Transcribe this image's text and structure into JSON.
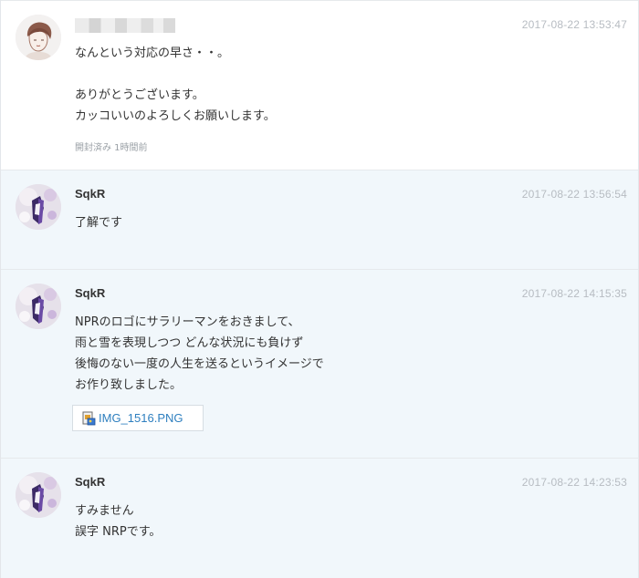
{
  "messages": [
    {
      "sender": "",
      "timestamp": "2017-08-22 13:53:47",
      "lines": [
        "なんという対応の早さ・・。",
        "",
        "ありがとうございます。",
        "カッコいいのよろしくお願いします。"
      ],
      "read_status": "開封済み 1時間前"
    },
    {
      "sender": "SqkR",
      "timestamp": "2017-08-22 13:56:54",
      "lines": [
        "了解です"
      ]
    },
    {
      "sender": "SqkR",
      "timestamp": "2017-08-22 14:15:35",
      "lines": [
        "NPRのロゴにサラリーマンをおきまして、",
        "雨と雪を表現しつつ どんな状況にも負けず",
        "後悔のない一度の人生を送るというイメージで",
        "お作り致しました。"
      ],
      "attachment": {
        "name": "IMG_1516.PNG",
        "icon": "image-file-icon"
      }
    },
    {
      "sender": "SqkR",
      "timestamp": "2017-08-22 14:23:53",
      "lines": [
        "すみません",
        "誤字 NRPです。"
      ]
    }
  ],
  "colors": {
    "own_message_bg": "#ffffff",
    "other_message_bg": "#f1f7fb",
    "timestamp": "#b7bcc2",
    "link": "#2e7fbf"
  }
}
